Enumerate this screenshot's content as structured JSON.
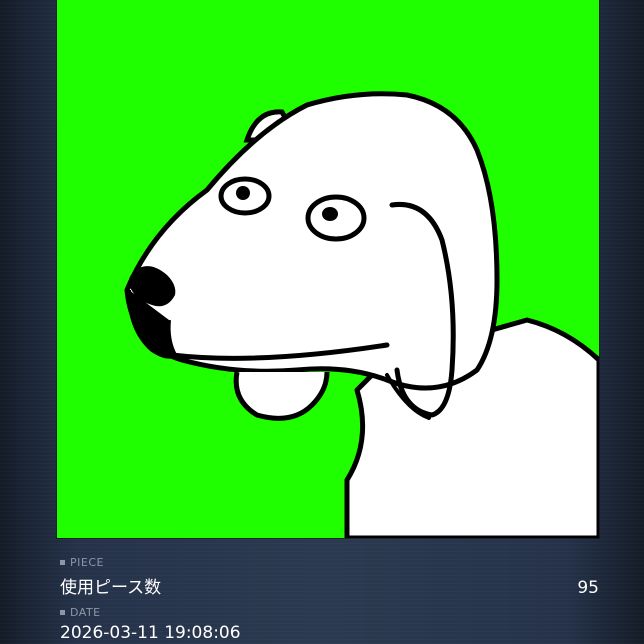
{
  "artwork": {
    "background_color": "#20ff00",
    "subject": "dog-illustration"
  },
  "piece": {
    "label": "PIECE",
    "title": "使用ピース数",
    "count": "95"
  },
  "date": {
    "label": "DATE",
    "value": "2026-03-11 19:08:06"
  }
}
